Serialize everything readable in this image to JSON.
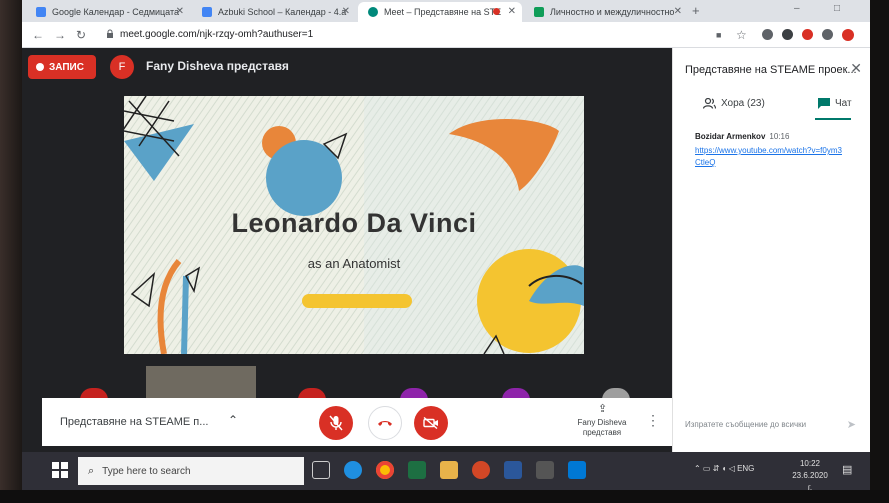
{
  "browser": {
    "tabs": [
      {
        "title": "Google Календар - Седмицата",
        "color": "#4285f4",
        "active": false
      },
      {
        "title": "Azbuki School – Календар - 4.а",
        "color": "#4285f4",
        "active": false
      },
      {
        "title": "Meet – Представяне на STE",
        "color": "#00897b",
        "active": true
      },
      {
        "title": "Личностно и междуличностно",
        "color": "#0f9d58",
        "active": false
      }
    ],
    "new_tab": "+",
    "url": "meet.google.com/njk-rzqy-omh?authuser=1"
  },
  "meet": {
    "record_label": "ЗАПИС",
    "presenter_initial": "F",
    "presenter_text": "Fany Disheva представя",
    "meeting_name": "Представяне на STEAME п...",
    "present_label": "Fany Disheva представя",
    "accent": "#d93025"
  },
  "slide": {
    "title": "Leonardo Da Vinci",
    "subtitle": "as an Anatomist"
  },
  "panel": {
    "title": "Представяне на STEAME проек...",
    "tab_people": "Хора (23)",
    "tab_chat": "Чат",
    "message": {
      "sender": "Bozidar Armenkov",
      "time": "10:16",
      "link": "https://www.youtube.com/watch?v=f0ym3CtleQ"
    },
    "input_placeholder": "Изпратете съобщение до всички"
  },
  "taskbar": {
    "search_placeholder": "Type here to search",
    "language": "ENG",
    "time": "10:22",
    "date": "23.6.2020 г."
  }
}
